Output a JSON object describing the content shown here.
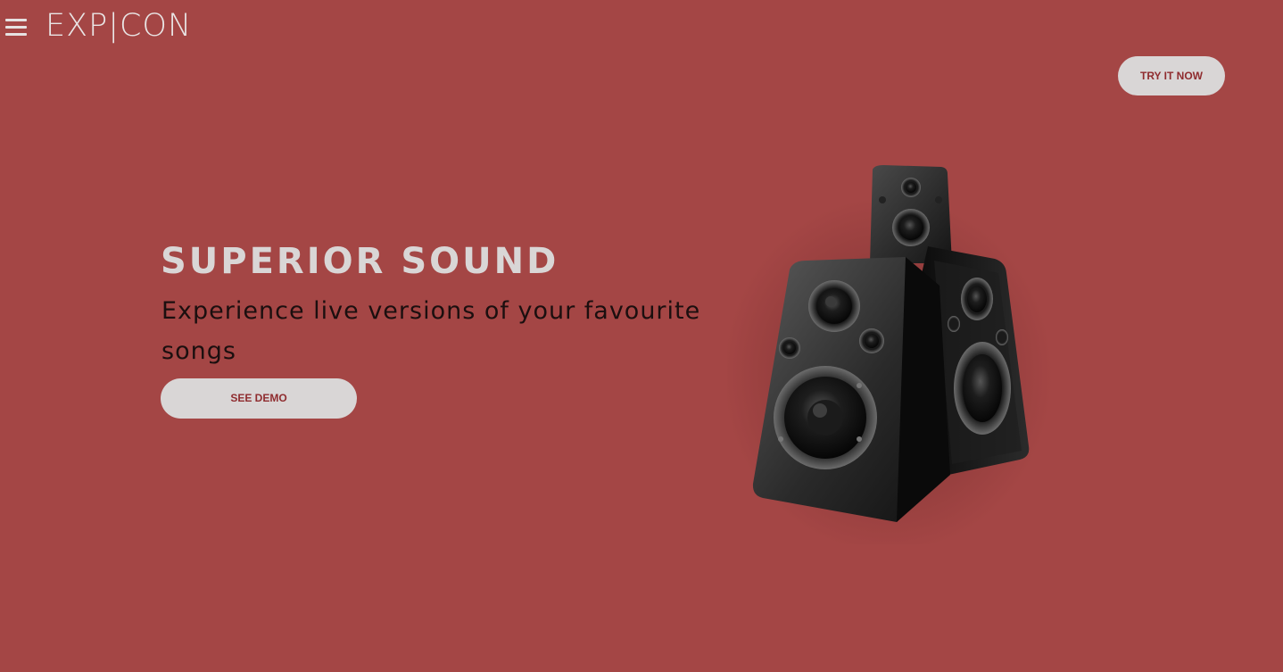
{
  "brand": {
    "logo_text": "EXP|CON"
  },
  "header": {
    "menu_icon": "hamburger-menu-icon",
    "cta_label": "TRY IT NOW"
  },
  "hero": {
    "title": "SUPERIOR SOUND",
    "subtitle": "Experience live versions of your favourite songs",
    "button_label": "SEE DEMO",
    "image": "speakers-image"
  },
  "colors": {
    "background": "#a44645",
    "button_bg": "#d9d6d6",
    "button_text": "#8f2c2f",
    "title": "#d9d6d6",
    "subtitle": "#1b0f0f"
  }
}
